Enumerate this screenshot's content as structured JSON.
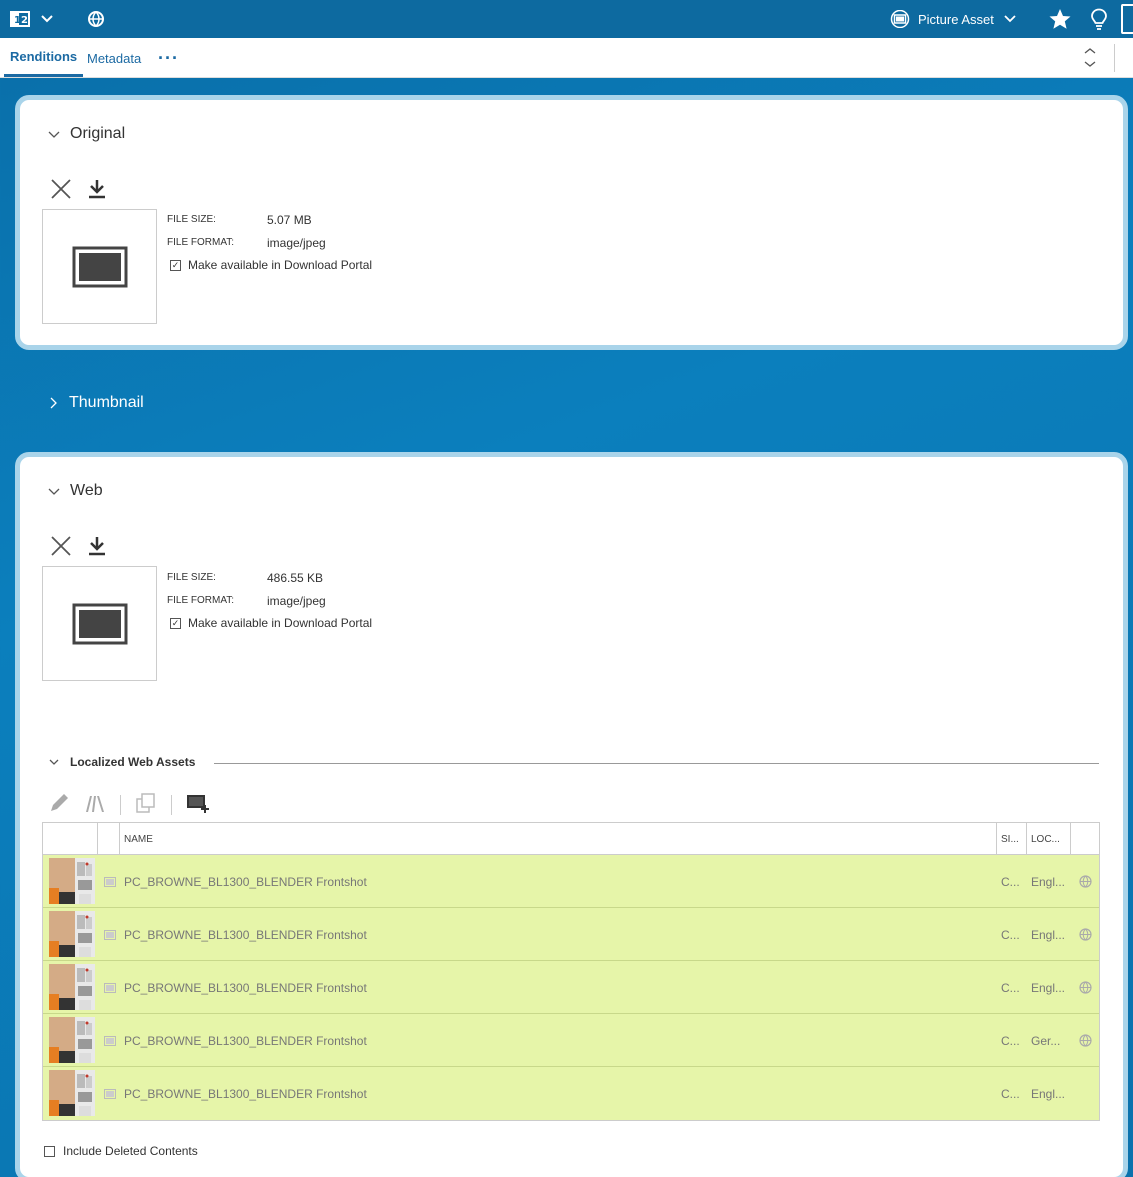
{
  "topbar": {
    "count_icon_text": "1|2",
    "asset_type": "Picture Asset"
  },
  "tabs": [
    {
      "label": "Renditions",
      "active": true
    },
    {
      "label": "Metadata",
      "active": false
    }
  ],
  "tab_more": "···",
  "renditions": {
    "original": {
      "title": "Original",
      "file_size_label": "FILE SIZE:",
      "file_size": "5.07 MB",
      "file_format_label": "FILE FORMAT:",
      "file_format": "image/jpeg",
      "download_portal_label": "Make available in Download Portal",
      "download_portal_checked": true
    },
    "thumbnail": {
      "title": "Thumbnail"
    },
    "web": {
      "title": "Web",
      "file_size_label": "FILE SIZE:",
      "file_size": "486.55 KB",
      "file_format_label": "FILE FORMAT:",
      "file_format": "image/jpeg",
      "download_portal_label": "Make available in Download Portal",
      "download_portal_checked": true
    }
  },
  "localized_web_assets": {
    "title": "Localized Web Assets",
    "columns": {
      "name": "NAME",
      "size": "SI...",
      "locale": "LOC..."
    },
    "rows": [
      {
        "name": "PC_BROWNE_BL1300_BLENDER Frontshot",
        "size": "C...",
        "locale": "Engl...",
        "has_globe": true
      },
      {
        "name": "PC_BROWNE_BL1300_BLENDER Frontshot",
        "size": "C...",
        "locale": "Engl...",
        "has_globe": true
      },
      {
        "name": "PC_BROWNE_BL1300_BLENDER Frontshot",
        "size": "C...",
        "locale": "Engl...",
        "has_globe": true
      },
      {
        "name": "PC_BROWNE_BL1300_BLENDER Frontshot",
        "size": "C...",
        "locale": "Ger...",
        "has_globe": true
      },
      {
        "name": "PC_BROWNE_BL1300_BLENDER Frontshot",
        "size": "C...",
        "locale": "Engl...",
        "has_globe": false
      }
    ]
  },
  "include_deleted_label": "Include Deleted Contents",
  "colors": {
    "topbar": "#0d6aa0",
    "accent": "#1c6aa3",
    "row_highlight": "#e6f5a9",
    "card_border": "#a9d4ea"
  }
}
